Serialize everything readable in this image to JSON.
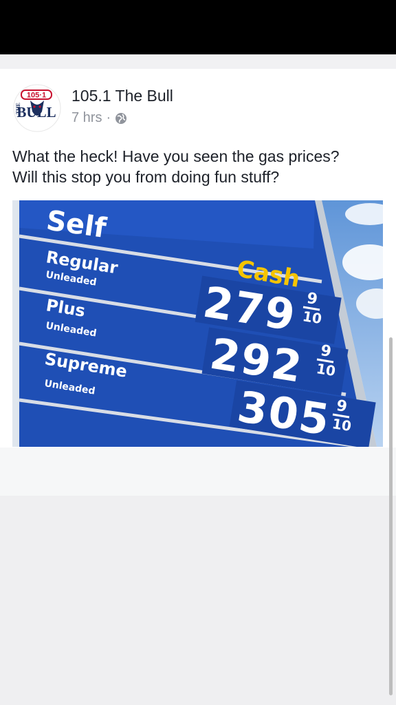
{
  "post": {
    "page_name": "105.1 The Bull",
    "time": "7 hrs",
    "separator": "·",
    "privacy_icon": "globe-icon",
    "text_line1": "What the heck! Have you seen the gas prices?",
    "text_line2": "Will this stop you from doing fun stuff?"
  },
  "avatar_logo": {
    "frequency": "105·1",
    "the": "THE",
    "bull": "BULL"
  },
  "sign": {
    "header": "Self",
    "payment": "Cash",
    "grades": [
      {
        "name": "Regular",
        "sub": "Unleaded",
        "price": "279",
        "fraction_top": "9",
        "fraction_bottom": "10"
      },
      {
        "name": "Plus",
        "sub": "Unleaded",
        "price": "292",
        "fraction_top": "9",
        "fraction_bottom": "10"
      },
      {
        "name": "Supreme",
        "sub": "Unleaded",
        "price": "305",
        "fraction_top": "9",
        "fraction_bottom": "10"
      }
    ]
  },
  "colors": {
    "sign_blue": "#1f4fb5",
    "cash_yellow": "#f5c400",
    "name_text": "#1d2129",
    "meta_text": "#90949c"
  }
}
